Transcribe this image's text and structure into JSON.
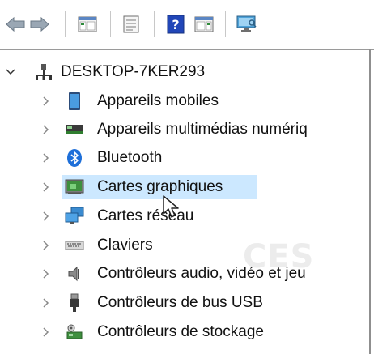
{
  "toolbar": {
    "buttons": [
      {
        "name": "back-button",
        "icon": "arrow-left-icon"
      },
      {
        "name": "forward-button",
        "icon": "arrow-right-icon"
      },
      {
        "name": "show-hide-console-tree-button",
        "icon": "console-tree-icon"
      },
      {
        "name": "properties-button",
        "icon": "properties-icon"
      },
      {
        "name": "help-button",
        "icon": "help-icon",
        "glyph": "?"
      },
      {
        "name": "show-action-pane-button",
        "icon": "action-pane-icon"
      },
      {
        "name": "scan-hardware-button",
        "icon": "monitor-scan-icon"
      }
    ]
  },
  "tree": {
    "root": {
      "label": "DESKTOP-7KER293",
      "icon": "computer-icon",
      "expanded": true
    },
    "items": [
      {
        "label": "Appareils mobiles",
        "icon": "mobile-device-icon"
      },
      {
        "label": "Appareils multimédias numériq",
        "icon": "media-device-icon"
      },
      {
        "label": "Bluetooth",
        "icon": "bluetooth-icon"
      },
      {
        "label": "Cartes graphiques",
        "icon": "display-adapter-icon",
        "selected": true
      },
      {
        "label": "Cartes réseau",
        "icon": "network-adapter-icon"
      },
      {
        "label": "Claviers",
        "icon": "keyboard-icon"
      },
      {
        "label": "Contrôleurs audio, vidéo et jeu",
        "icon": "speaker-icon"
      },
      {
        "label": "Contrôleurs de bus USB",
        "icon": "usb-icon"
      },
      {
        "label": "Contrôleurs de stockage",
        "icon": "storage-controller-icon"
      }
    ]
  },
  "watermark": {
    "text": "CES"
  },
  "colors": {
    "selection": "#cce8ff",
    "bluetooth": "#1e6fd9",
    "help": "#2146b8"
  }
}
